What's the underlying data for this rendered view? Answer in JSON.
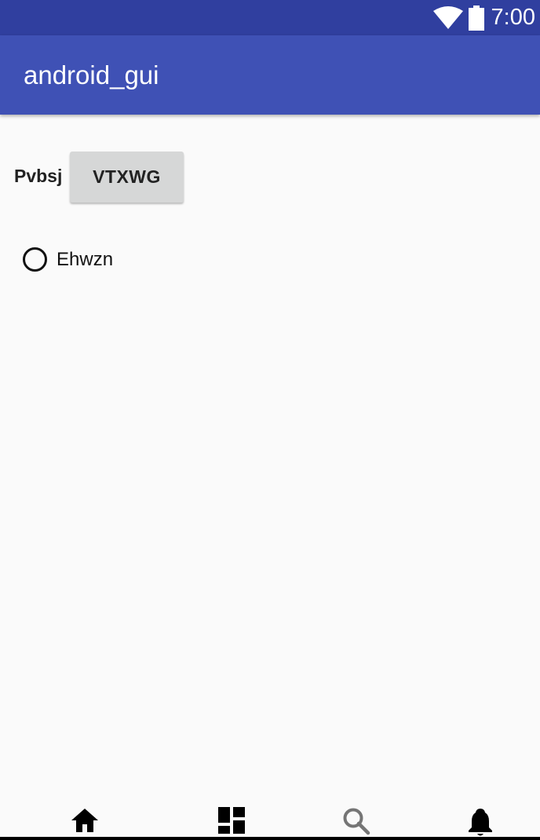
{
  "status_bar": {
    "time": "7:00",
    "icons": [
      "wifi-icon",
      "battery-icon"
    ]
  },
  "app_bar": {
    "title": "android_gui"
  },
  "content": {
    "label": "Pvbsj",
    "button_label": "VTXWG",
    "radio_label": "Ehwzn"
  },
  "bottom_nav": {
    "icons": [
      "home-icon",
      "dashboard-icon",
      "search-icon",
      "notifications-icon"
    ]
  }
}
